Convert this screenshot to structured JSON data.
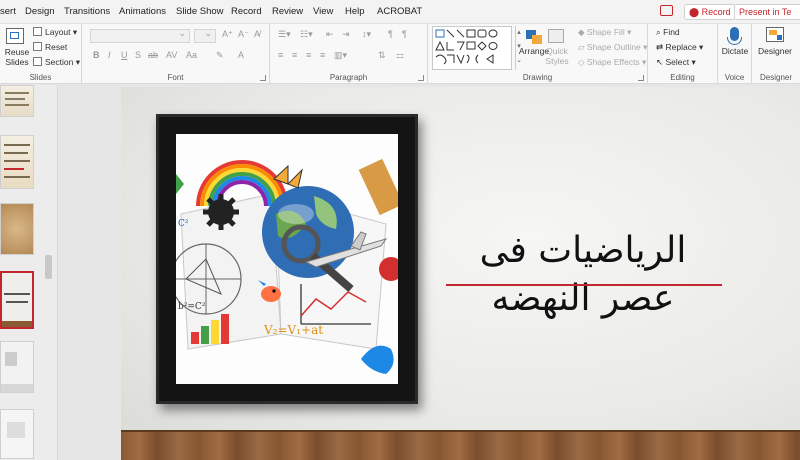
{
  "menubar": {
    "tabs": [
      "sert",
      "Design",
      "Transitions",
      "Animations",
      "Slide Show",
      "Record",
      "Review",
      "View",
      "Help",
      "ACROBAT"
    ],
    "record_button": "⬤ Record",
    "present_button": "Present in Te"
  },
  "ribbon": {
    "slides": {
      "label": "Slides",
      "reuse": "Reuse\nSlides",
      "layout": "Layout",
      "reset": "Reset",
      "section": "Section"
    },
    "font": {
      "label": "Font"
    },
    "paragraph": {
      "label": "Paragraph"
    },
    "drawing": {
      "label": "Drawing",
      "arrange": "Arrange",
      "quick_styles": "Quick\nStyles",
      "shape_fill": "Shape Fill",
      "shape_outline": "Shape Outline",
      "shape_effects": "Shape Effects"
    },
    "editing": {
      "label": "Editing",
      "find": "Find",
      "replace": "Replace",
      "select": "Select"
    },
    "voice": {
      "label": "Voice",
      "dictate": "Dictate"
    },
    "designer": {
      "label": "Designer",
      "designer": "Designer"
    }
  },
  "slide": {
    "title_line1": "الرياضيات فى",
    "title_line2": "عصر النهضه",
    "picture_formulas": [
      "V₂=V₁+at",
      "C²",
      "b²=C²"
    ]
  },
  "colors": {
    "accent": "#c4262e",
    "ribbon_bg": "#f8f8f8",
    "menubar_bg": "#f3f3f3"
  }
}
